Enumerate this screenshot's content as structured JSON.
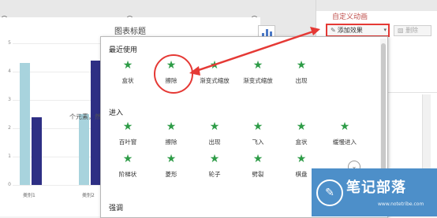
{
  "chart": {
    "title": "图表标题",
    "ticks": [
      "5",
      "4",
      "3",
      "2",
      "1",
      "0"
    ],
    "categories": [
      "类别1",
      "类别2"
    ]
  },
  "chart_data": {
    "type": "bar",
    "title": "图表标题",
    "categories": [
      "类别1",
      "类别2"
    ],
    "series": [
      {
        "values": [
          4.3,
          2.5
        ]
      },
      {
        "values": [
          2.4,
          4.4
        ]
      }
    ],
    "ylim": [
      0,
      5
    ]
  },
  "pane": {
    "title": "自定义动画",
    "add_label": "添加效果",
    "delete_label": "删除",
    "hint": "个元素，然后单击"
  },
  "dropdown": {
    "recent_title": "最近使用",
    "enter_title": "进入",
    "emphasis_title": "强调",
    "recent": [
      "盒状",
      "擦除",
      "渐变式缩放",
      "渐变式缩放",
      "出现"
    ],
    "enter_row1": [
      "百叶窗",
      "擦除",
      "出现",
      "飞入",
      "盒状",
      "缓慢进入"
    ],
    "enter_row2": [
      "阶梯状",
      "菱形",
      "轮子",
      "劈裂",
      "棋盘"
    ]
  },
  "watermark": {
    "title": "笔记部落",
    "url": "www.notetribe.com"
  },
  "colors": {
    "series1": "#a8d3dd",
    "series2": "#2e2f84",
    "highlight": "#e53935",
    "star": "#2e9c47"
  }
}
